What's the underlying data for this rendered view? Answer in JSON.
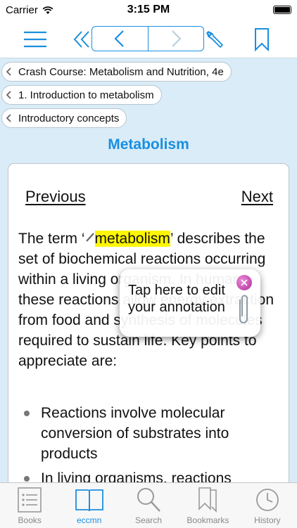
{
  "status_bar": {
    "carrier": "Carrier",
    "time": "3:15 PM",
    "battery_percent": 100
  },
  "toolbar": {
    "menu_icon": "menu-icon",
    "back_icon": "double-chevron-left-icon",
    "prev_icon": "chevron-left-icon",
    "next_icon": "chevron-right-icon",
    "tools_icon": "wrench-icon",
    "bookmark_icon": "bookmark-icon"
  },
  "breadcrumbs": [
    "Crash Course: Metabolism and Nutrition, 4e",
    "1. Introduction to metabolism",
    "Introductory concepts"
  ],
  "section_title": "Metabolism",
  "content": {
    "previous_label": "Previous",
    "next_label": "Next",
    "para_before": "The term ‘",
    "highlight": "metabolism",
    "para_after": "’ describes the set of biochemical reactions occurring within a living organism. In humans these reactions allow energy extraction from food and synthesis of molecules required to sustain life. Key points to appreciate are:",
    "bullets": [
      "Reactions involve molecular conversion of substrates into products",
      "In living organisms, reactions"
    ]
  },
  "annotation": {
    "text": "Tap here to edit your annotation"
  },
  "tabbar": {
    "items": [
      {
        "label": "Books",
        "icon": "list-icon"
      },
      {
        "label": "eccmn",
        "icon": "open-book-icon"
      },
      {
        "label": "Search",
        "icon": "search-icon"
      },
      {
        "label": "Bookmarks",
        "icon": "bookmarks-icon"
      },
      {
        "label": "History",
        "icon": "history-clock-icon"
      }
    ],
    "active_index": 1
  },
  "colors": {
    "accent": "#1a8fe0",
    "highlight": "#fff700",
    "background": "#d9ecf7"
  }
}
